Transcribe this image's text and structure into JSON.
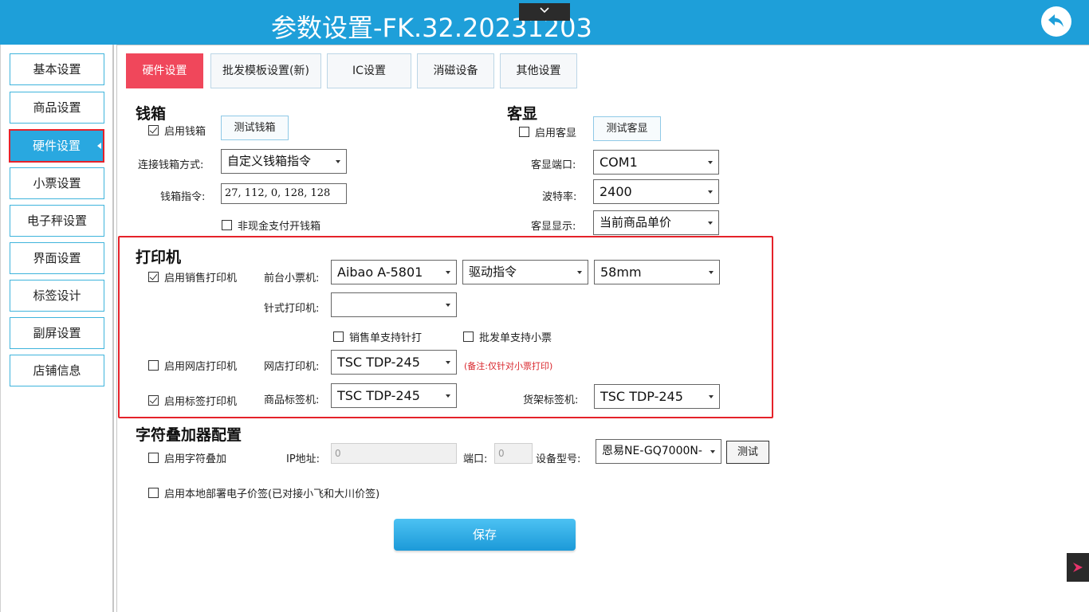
{
  "header": {
    "title": "参数设置-FK.32.20231203"
  },
  "sidebar": {
    "items": [
      {
        "label": "基本设置"
      },
      {
        "label": "商品设置"
      },
      {
        "label": "硬件设置"
      },
      {
        "label": "小票设置"
      },
      {
        "label": "电子秤设置"
      },
      {
        "label": "界面设置"
      },
      {
        "label": "标签设计"
      },
      {
        "label": "副屏设置"
      },
      {
        "label": "店铺信息"
      }
    ],
    "active_index": 2
  },
  "tabs": [
    {
      "label": "硬件设置"
    },
    {
      "label": "批发模板设置(新)"
    },
    {
      "label": "IC设置"
    },
    {
      "label": "消磁设备"
    },
    {
      "label": "其他设置"
    }
  ],
  "cashbox": {
    "title": "钱箱",
    "enable_label": "启用钱箱",
    "enable_checked": true,
    "test_label": "测试钱箱",
    "method_label": "连接钱箱方式:",
    "method_value": "自定义钱箱指令",
    "command_label": "钱箱指令:",
    "command_value": "27, 112, 0, 128, 128",
    "noncash_label": "非现金支付开钱箱",
    "noncash_checked": false
  },
  "customer_display": {
    "title": "客显",
    "enable_label": "启用客显",
    "enable_checked": false,
    "test_label": "测试客显",
    "port_label": "客显端口:",
    "port_value": "COM1",
    "baud_label": "波特率:",
    "baud_value": "2400",
    "display_label": "客显显示:",
    "display_value": "当前商品单价"
  },
  "printer": {
    "title": "打印机",
    "sales_enable_label": "启用销售打印机",
    "sales_enable_checked": true,
    "receipt_printer_label": "前台小票机:",
    "receipt_printer_value": "Aibao A-5801",
    "driver_value": "驱动指令",
    "paper_value": "58mm",
    "dot_printer_label": "针式打印机:",
    "dot_printer_value": "",
    "sales_dot_label": "销售单支持针打",
    "sales_dot_checked": false,
    "wholesale_receipt_label": "批发单支持小票",
    "wholesale_receipt_checked": false,
    "online_enable_label": "启用网店打印机",
    "online_enable_checked": false,
    "online_printer_label": "网店打印机:",
    "online_printer_value": "TSC TDP-245",
    "online_note": "(备注:仅针对小票打印)",
    "label_enable_label": "启用标签打印机",
    "label_enable_checked": true,
    "goods_label_label": "商品标签机:",
    "goods_label_value": "TSC TDP-245",
    "shelf_label_label": "货架标签机:",
    "shelf_label_value": "TSC TDP-245"
  },
  "overlay": {
    "title": "字符叠加器配置",
    "enable_label": "启用字符叠加",
    "enable_checked": false,
    "ip_label": "IP地址:",
    "ip_value": "0",
    "port_label": "端口:",
    "port_value": "0",
    "model_label": "设备型号:",
    "model_value": "恩易NE-GQ7000N-",
    "test_label": "测试",
    "esl_label": "启用本地部署电子价签(已对接小飞和大川价签)",
    "esl_checked": false
  },
  "save_label": "保存",
  "colors": {
    "titlebar": "#1e9fd9",
    "active_tab": "#f0475b",
    "highlight": "#e5222a"
  }
}
